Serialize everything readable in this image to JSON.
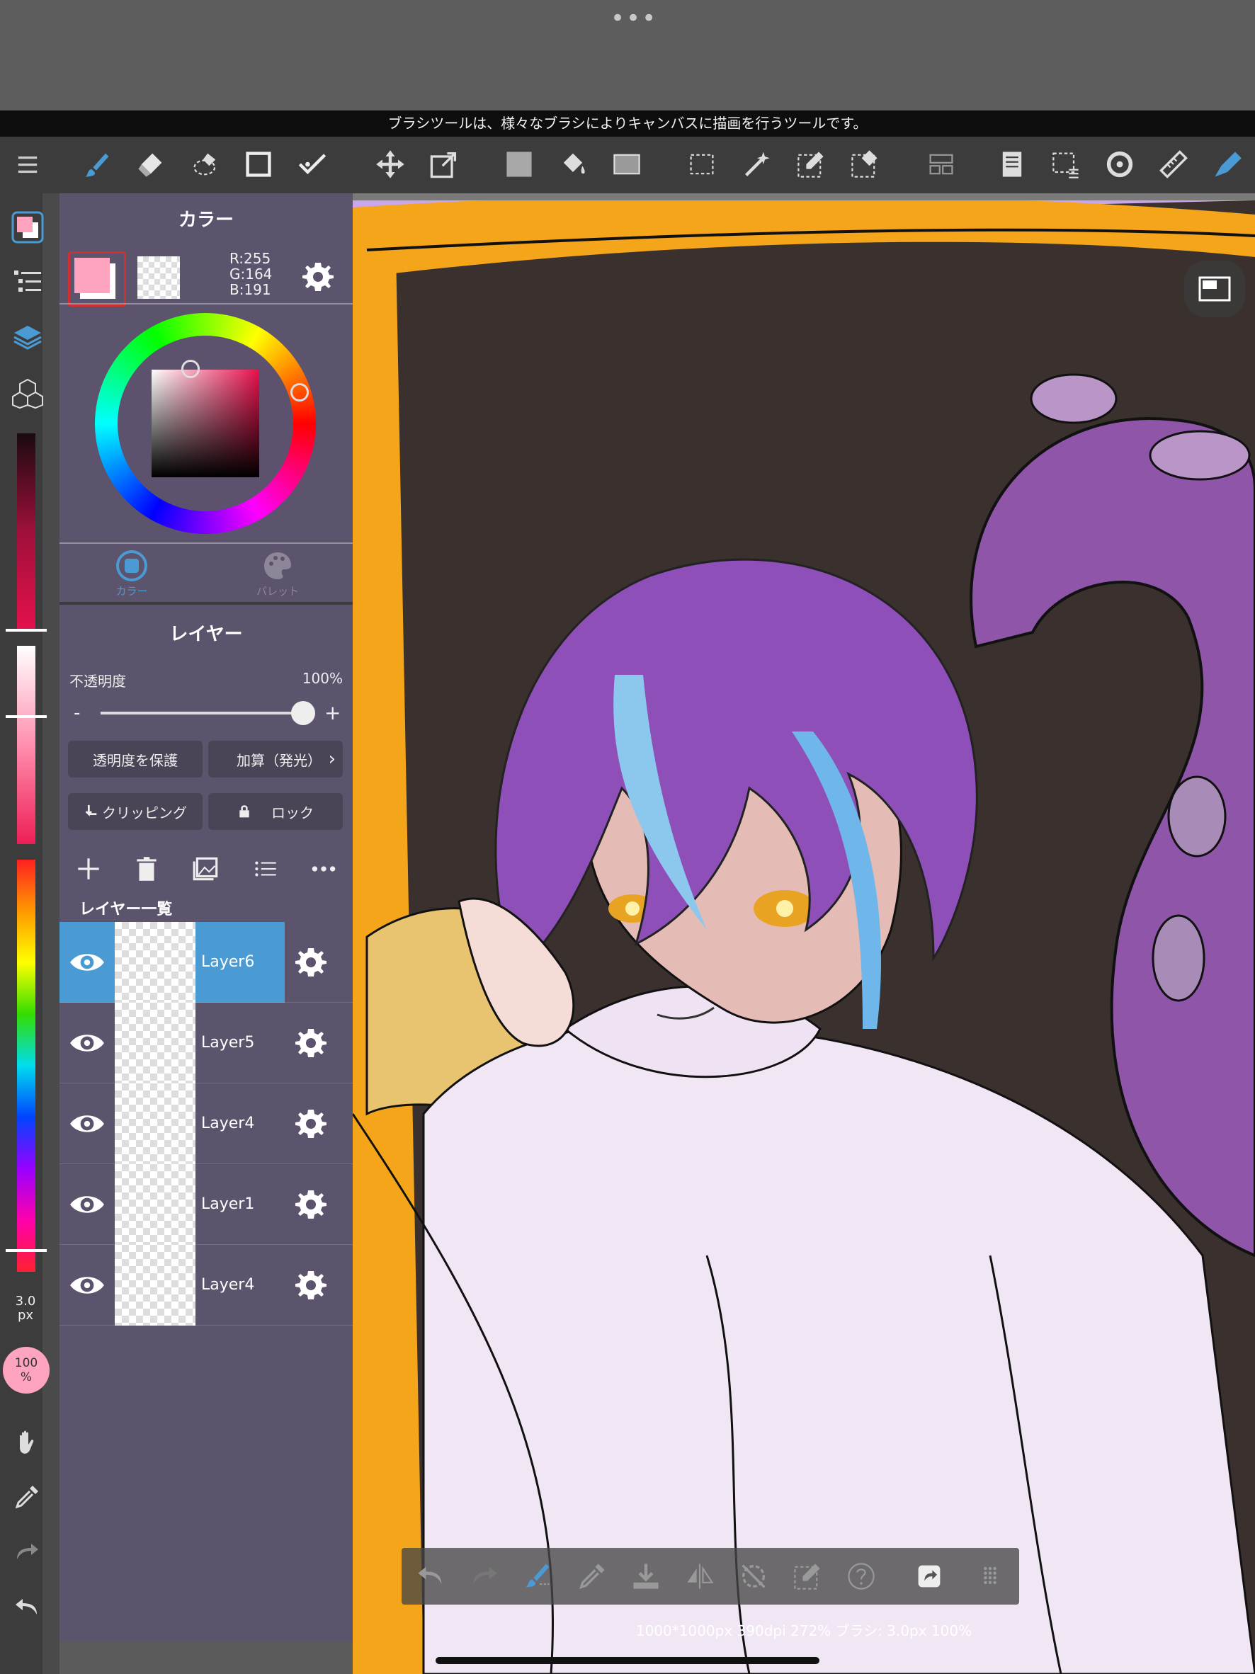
{
  "hint": "ブラシツールは、様々なブラシによりキャンバスに描画を行うツールです。",
  "toolbar_icons": [
    "menu-icon",
    "brush-icon",
    "eraser-icon",
    "lasso-eraser-icon",
    "rectangle-icon",
    "check-icon",
    "move-icon",
    "transform-icon",
    "fill-color-icon",
    "bucket-icon",
    "gradient-icon",
    "marquee-select-icon",
    "magic-wand-icon",
    "select-pen-icon",
    "select-eraser-icon",
    "layout-icon",
    "layer-list-icon",
    "select-menu-icon",
    "rotate-icon",
    "ruler-icon",
    "snap-icon"
  ],
  "color_panel": {
    "title": "カラー",
    "main_color": "#ffa4bf",
    "r": "R:255",
    "g": "G:164",
    "b": "B:191",
    "tab_color": "カラー",
    "tab_palette": "パレット"
  },
  "layer_panel": {
    "title": "レイヤー",
    "opacity_label": "不透明度",
    "opacity_value": "100%",
    "opacity_fraction": 1.0,
    "minus": "-",
    "plus": "+",
    "protect_alpha": "透明度を保護",
    "blend_mode": "加算（発光）",
    "clipping": "クリッピング",
    "lock": "ロック",
    "list_title": "レイヤー一覧",
    "layers": [
      {
        "name": "Layer6",
        "selected": true
      },
      {
        "name": "Layer5",
        "selected": false
      },
      {
        "name": "Layer4",
        "selected": false
      },
      {
        "name": "Layer1",
        "selected": false
      },
      {
        "name": "Layer4",
        "selected": false
      }
    ]
  },
  "brush_size": {
    "value": "3.0",
    "unit": "px"
  },
  "brush_opacity": {
    "value": "100",
    "unit": "%"
  },
  "status": "1000*1000px 390dpi 272% ブラシ: 3.0px 100%",
  "accent": "#4a9ad4"
}
